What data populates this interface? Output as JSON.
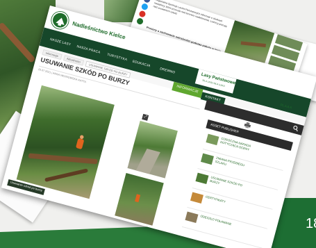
{
  "site": {
    "name": "Nadleśnictwo Kielce",
    "brand": "Lasy Państwowe",
    "brand_tagline": "SILA LASU SILA LUDZI",
    "lang": "PL  A A A"
  },
  "nav": {
    "items": [
      {
        "label": "NASZE LASY"
      },
      {
        "label": "NASZA PRACA"
      },
      {
        "label": "TURYSTYKA"
      },
      {
        "label": "EDUKACJA"
      },
      {
        "label": "DREWNO"
      },
      {
        "label": "INFORMACJE",
        "active": true
      },
      {
        "label": "KONTAKT"
      }
    ]
  },
  "breadcrumb": [
    "Informacje",
    "Aktualności",
    "USUWANIE SZKÓD PO BURZY"
  ],
  "article": {
    "title": "USUWANIE SZKÓD PO BURZY",
    "meta": "15.07.2021  |  ANNA WOJNOWSKA-KATTA",
    "photo_caption": "Usuwanie szkód po burzy"
  },
  "publisher": {
    "heading": "ASSET PUBLISHER",
    "items": [
      {
        "label": "COROCZNA NARADA DOTYCZĄCA OCENY"
      },
      {
        "label": "ZMIANA PRZEBIEGU SZLAKU"
      },
      {
        "label": "USUWANIE SZKÓD PO BURZY"
      },
      {
        "label": "CERTYFIKATY"
      },
      {
        "label": "ODESZŁO POŁAMANE"
      }
    ]
  },
  "top_card": {
    "text": "Regionalna Dyrekcja Lasów Państwowych informuje o skutkach nawałnicy, która przeszła nad terenem nadleśnictwa. Leśnicy pracują nad usuwaniem szkód.",
    "bold": "Prosimy o zachowanie ostrożności podczas pobytu w lesie."
  },
  "page_number": "18",
  "colors": {
    "brand_green": "#1e6c2a",
    "nav_dark": "#16472a",
    "nav_active": "#5fa72f",
    "footer_green": "#2a7b3a"
  }
}
